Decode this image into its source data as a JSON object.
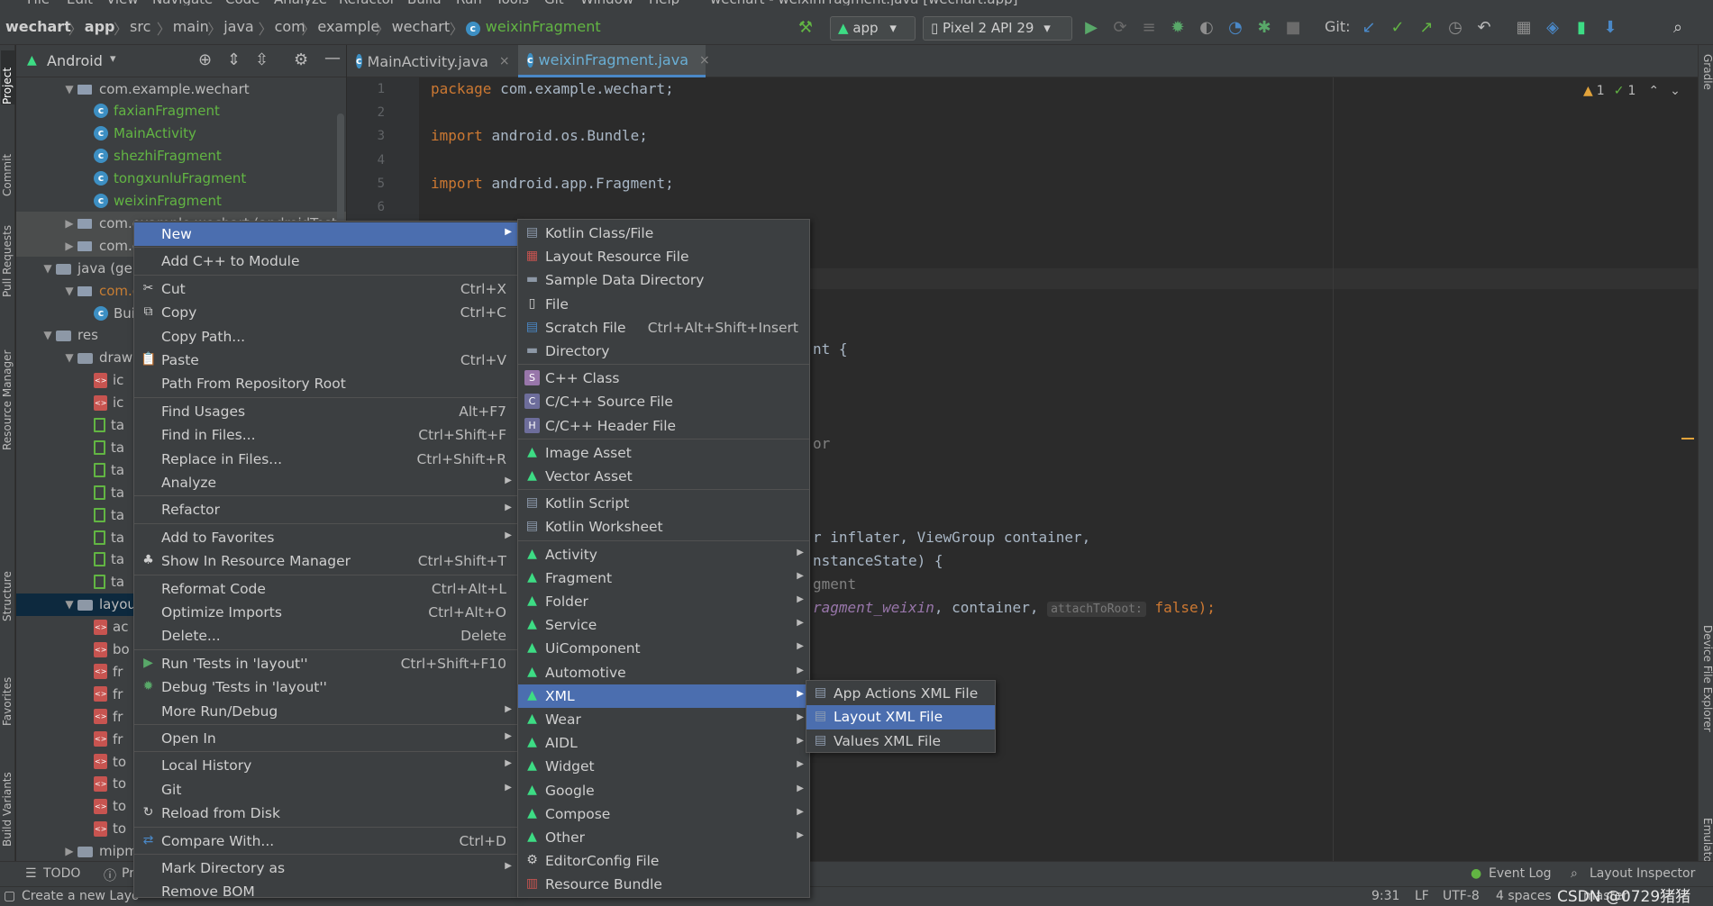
{
  "menubar": {
    "items": [
      "File",
      "Edit",
      "View",
      "Navigate",
      "Code",
      "Analyze",
      "Refactor",
      "Build",
      "Run",
      "Tools",
      "Git",
      "Window",
      "Help"
    ],
    "title": "wechart - weixinFragment.java [wechart.app]"
  },
  "breadcrumb": [
    "wechart",
    "app",
    "src",
    "main",
    "java",
    "com",
    "example",
    "wechart",
    "weixinFragment"
  ],
  "toolbar": {
    "run_config": "app",
    "device": "Pixel 2 API 29",
    "git_label": "Git:"
  },
  "left_stripe": [
    "Project",
    "Commit",
    "Pull Requests",
    "Resource Manager",
    "Structure",
    "Favorites",
    "Build Variants"
  ],
  "right_stripe": [
    "Gradle",
    "Device File Explorer",
    "Emulator"
  ],
  "project": {
    "view_label": "Android",
    "tree": [
      {
        "label": "com.example.wechart",
        "type": "package",
        "depth": 2,
        "expanded": true
      },
      {
        "label": "faxianFragment",
        "type": "class",
        "depth": 3
      },
      {
        "label": "MainActivity",
        "type": "class",
        "depth": 3
      },
      {
        "label": "shezhiFragment",
        "type": "class",
        "depth": 3
      },
      {
        "label": "tongxunluFragment",
        "type": "class",
        "depth": 3
      },
      {
        "label": "weixinFragment",
        "type": "class",
        "depth": 3
      },
      {
        "label": "com.example.wechart (androidTest)",
        "type": "package",
        "depth": 2,
        "expanded": false
      },
      {
        "label": "com.example.wechart (test)",
        "type": "package",
        "depth": 2,
        "expanded": false
      },
      {
        "label": "java (generated)",
        "type": "folder",
        "depth": 1,
        "expanded": true
      },
      {
        "label": "com.example.wechart",
        "type": "package",
        "depth": 2,
        "expanded": true
      },
      {
        "label": "BuildConfig",
        "type": "class",
        "depth": 3
      },
      {
        "label": "res",
        "type": "folder",
        "depth": 1,
        "expanded": true
      },
      {
        "label": "drawable",
        "type": "folder",
        "depth": 2,
        "expanded": true
      },
      {
        "label": "ic",
        "type": "xml",
        "depth": 3
      },
      {
        "label": "ic",
        "type": "xml",
        "depth": 3
      },
      {
        "label": "ta",
        "type": "file",
        "depth": 3
      },
      {
        "label": "ta",
        "type": "file",
        "depth": 3
      },
      {
        "label": "ta",
        "type": "file",
        "depth": 3
      },
      {
        "label": "ta",
        "type": "file",
        "depth": 3
      },
      {
        "label": "ta",
        "type": "file",
        "depth": 3
      },
      {
        "label": "ta",
        "type": "file",
        "depth": 3
      },
      {
        "label": "ta",
        "type": "file",
        "depth": 3
      },
      {
        "label": "ta",
        "type": "file",
        "depth": 3
      },
      {
        "label": "layout",
        "type": "folder",
        "depth": 2,
        "expanded": true,
        "selected": true
      },
      {
        "label": "ac",
        "type": "xml",
        "depth": 3
      },
      {
        "label": "bo",
        "type": "xml",
        "depth": 3
      },
      {
        "label": "fr",
        "type": "xml",
        "depth": 3
      },
      {
        "label": "fr",
        "type": "xml",
        "depth": 3
      },
      {
        "label": "fr",
        "type": "xml",
        "depth": 3
      },
      {
        "label": "fr",
        "type": "xml",
        "depth": 3
      },
      {
        "label": "to",
        "type": "xml",
        "depth": 3
      },
      {
        "label": "to",
        "type": "xml",
        "depth": 3
      },
      {
        "label": "to",
        "type": "xml",
        "depth": 3
      },
      {
        "label": "to",
        "type": "xml",
        "depth": 3
      },
      {
        "label": "mipmap",
        "type": "folder",
        "depth": 2,
        "expanded": false
      }
    ]
  },
  "tabs": [
    {
      "label": "MainActivity.java",
      "active": false
    },
    {
      "label": "weixinFragment.java",
      "active": true
    }
  ],
  "editor": {
    "line_numbers": [
      "1",
      "2",
      "3",
      "4",
      "5",
      "6"
    ],
    "lines": [
      {
        "parts": [
          [
            "kw",
            "package "
          ],
          [
            "",
            "com.example.wechart;"
          ]
        ]
      },
      {
        "parts": []
      },
      {
        "parts": [
          [
            "kw",
            "import "
          ],
          [
            "",
            "android.os.Bundle;"
          ]
        ]
      },
      {
        "parts": []
      },
      {
        "parts": [
          [
            "kw",
            "import "
          ],
          [
            "",
            "android.app.Fragment;"
          ]
        ]
      }
    ],
    "visible_fragments": {
      "class_tail": "nt {",
      "ctor_tail": "or",
      "method_line1": "r inflater, ViewGroup container,",
      "method_line2": "nstanceState) {",
      "comment": "gment",
      "return_prefix": "ragment_weixin",
      "return_mid": ", container, ",
      "hint": "attachToRoot:",
      "return_tail": " false);"
    },
    "inspection": {
      "warnings": "1",
      "ok": "1"
    }
  },
  "context_menu": {
    "items": [
      {
        "label": "New",
        "shortcut": "",
        "submenu": true,
        "active": true,
        "icon": ""
      },
      {
        "sep": true
      },
      {
        "label": "Add C++ to Module",
        "shortcut": "",
        "icon": ""
      },
      {
        "sep": true
      },
      {
        "label": "Cut",
        "shortcut": "Ctrl+X",
        "icon": "scissors-icon"
      },
      {
        "label": "Copy",
        "shortcut": "Ctrl+C",
        "icon": "copy-icon"
      },
      {
        "label": "Copy Path...",
        "shortcut": "",
        "icon": ""
      },
      {
        "label": "Paste",
        "shortcut": "Ctrl+V",
        "icon": "paste-icon"
      },
      {
        "label": "Path From Repository Root",
        "shortcut": "",
        "icon": ""
      },
      {
        "sep": true
      },
      {
        "label": "Find Usages",
        "shortcut": "Alt+F7",
        "icon": ""
      },
      {
        "label": "Find in Files...",
        "shortcut": "Ctrl+Shift+F",
        "icon": ""
      },
      {
        "label": "Replace in Files...",
        "shortcut": "Ctrl+Shift+R",
        "icon": ""
      },
      {
        "label": "Analyze",
        "shortcut": "",
        "submenu": true,
        "icon": ""
      },
      {
        "sep": true
      },
      {
        "label": "Refactor",
        "shortcut": "",
        "submenu": true,
        "icon": ""
      },
      {
        "sep": true
      },
      {
        "label": "Add to Favorites",
        "shortcut": "",
        "submenu": true,
        "icon": ""
      },
      {
        "label": "Show In Resource Manager",
        "shortcut": "Ctrl+Shift+T",
        "icon": "resource-icon"
      },
      {
        "sep": true
      },
      {
        "label": "Reformat Code",
        "shortcut": "Ctrl+Alt+L",
        "icon": ""
      },
      {
        "label": "Optimize Imports",
        "shortcut": "Ctrl+Alt+O",
        "icon": ""
      },
      {
        "label": "Delete...",
        "shortcut": "Delete",
        "icon": ""
      },
      {
        "sep": true
      },
      {
        "label": "Run 'Tests in 'layout''",
        "shortcut": "Ctrl+Shift+F10",
        "icon": "run-icon"
      },
      {
        "label": "Debug 'Tests in 'layout''",
        "shortcut": "",
        "icon": "debug-icon"
      },
      {
        "label": "More Run/Debug",
        "shortcut": "",
        "submenu": true,
        "icon": ""
      },
      {
        "sep": true
      },
      {
        "label": "Open In",
        "shortcut": "",
        "submenu": true,
        "icon": ""
      },
      {
        "sep": true
      },
      {
        "label": "Local History",
        "shortcut": "",
        "submenu": true,
        "icon": ""
      },
      {
        "label": "Git",
        "shortcut": "",
        "submenu": true,
        "icon": ""
      },
      {
        "label": "Reload from Disk",
        "shortcut": "",
        "icon": "reload-icon"
      },
      {
        "sep": true
      },
      {
        "label": "Compare With...",
        "shortcut": "Ctrl+D",
        "icon": "compare-icon"
      },
      {
        "sep": true
      },
      {
        "label": "Mark Directory as",
        "shortcut": "",
        "submenu": true,
        "icon": ""
      },
      {
        "label": "Remove BOM",
        "shortcut": "",
        "icon": ""
      }
    ]
  },
  "new_submenu": {
    "items": [
      {
        "label": "Kotlin Class/File",
        "shortcut": "",
        "icon": "kotlin-file-icon"
      },
      {
        "label": "Layout Resource File",
        "shortcut": "",
        "icon": "layout-file-icon"
      },
      {
        "label": "Sample Data Directory",
        "shortcut": "",
        "icon": "folder-icon"
      },
      {
        "label": "File",
        "shortcut": "",
        "icon": "file-icon"
      },
      {
        "label": "Scratch File",
        "shortcut": "Ctrl+Alt+Shift+Insert",
        "icon": "scratch-file-icon"
      },
      {
        "label": "Directory",
        "shortcut": "",
        "icon": "folder-icon"
      },
      {
        "sep": true
      },
      {
        "label": "C++ Class",
        "shortcut": "",
        "icon": "cpp-class-icon"
      },
      {
        "label": "C/C++ Source File",
        "shortcut": "",
        "icon": "cpp-source-icon"
      },
      {
        "label": "C/C++ Header File",
        "shortcut": "",
        "icon": "cpp-header-icon"
      },
      {
        "sep": true
      },
      {
        "label": "Image Asset",
        "shortcut": "",
        "icon": "android-icon"
      },
      {
        "label": "Vector Asset",
        "shortcut": "",
        "icon": "android-icon"
      },
      {
        "sep": true
      },
      {
        "label": "Kotlin Script",
        "shortcut": "",
        "icon": "kotlin-script-icon"
      },
      {
        "label": "Kotlin Worksheet",
        "shortcut": "",
        "icon": "kotlin-worksheet-icon"
      },
      {
        "sep": true
      },
      {
        "label": "Activity",
        "shortcut": "",
        "submenu": true,
        "icon": "android-icon"
      },
      {
        "label": "Fragment",
        "shortcut": "",
        "submenu": true,
        "icon": "android-icon"
      },
      {
        "label": "Folder",
        "shortcut": "",
        "submenu": true,
        "icon": "android-icon"
      },
      {
        "label": "Service",
        "shortcut": "",
        "submenu": true,
        "icon": "android-icon"
      },
      {
        "label": "UiComponent",
        "shortcut": "",
        "submenu": true,
        "icon": "android-icon"
      },
      {
        "label": "Automotive",
        "shortcut": "",
        "submenu": true,
        "icon": "android-icon"
      },
      {
        "label": "XML",
        "shortcut": "",
        "submenu": true,
        "active": true,
        "icon": "android-icon"
      },
      {
        "label": "Wear",
        "shortcut": "",
        "submenu": true,
        "icon": "android-icon"
      },
      {
        "label": "AIDL",
        "shortcut": "",
        "submenu": true,
        "icon": "android-icon"
      },
      {
        "label": "Widget",
        "shortcut": "",
        "submenu": true,
        "icon": "android-icon"
      },
      {
        "label": "Google",
        "shortcut": "",
        "submenu": true,
        "icon": "android-icon"
      },
      {
        "label": "Compose",
        "shortcut": "",
        "submenu": true,
        "icon": "android-icon"
      },
      {
        "label": "Other",
        "shortcut": "",
        "submenu": true,
        "icon": "android-icon"
      },
      {
        "label": "EditorConfig File",
        "shortcut": "",
        "icon": "gear-icon"
      },
      {
        "label": "Resource Bundle",
        "shortcut": "",
        "icon": "resource-bundle-icon"
      }
    ]
  },
  "xml_submenu": {
    "items": [
      {
        "label": "App Actions XML File",
        "active": false
      },
      {
        "label": "Layout XML File",
        "active": true
      },
      {
        "label": "Values XML File",
        "active": false
      }
    ]
  },
  "bottom_tools": {
    "todo": "TODO",
    "problems": "Pr",
    "event_log": "Event Log",
    "layout_inspector": "Layout Inspector"
  },
  "status": {
    "message": "Create a new Layo",
    "position": "9:31",
    "line_sep": "LF",
    "encoding": "UTF-8",
    "indent": "4 spaces",
    "branch": "master",
    "watermark": "CSDN @0729猪猪"
  },
  "colors": {
    "accent": "#4b6eaf",
    "android_green": "#3ddc84",
    "keyword": "#cc7832",
    "selection": "#0d293e"
  }
}
